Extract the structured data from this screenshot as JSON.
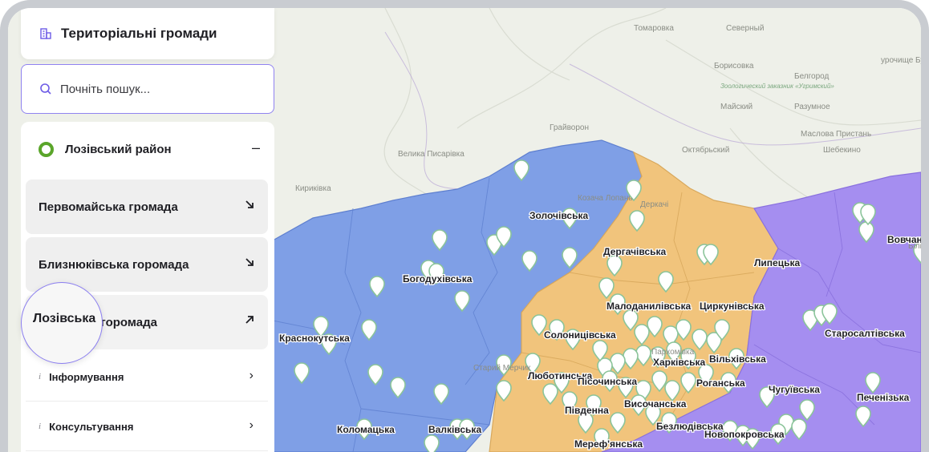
{
  "header": {
    "title": "Територіальні громади",
    "icon": "building-icon"
  },
  "search": {
    "placeholder": "Почніть пошук..."
  },
  "district": {
    "label": "Лозівський район",
    "toggle": "–",
    "color": "#5aa52a"
  },
  "communities": [
    {
      "label": "Первомайська громада",
      "arrow": "arrow-down-right-icon"
    },
    {
      "label": "Близнюківська горомада",
      "arrow": "arrow-down-right-icon"
    },
    {
      "label": "Лозівська горомада",
      "arrow": "arrow-up-right-icon",
      "expanded": true
    }
  ],
  "magnifier": {
    "label": "Лозівська"
  },
  "submenu": [
    {
      "icon": "i",
      "label": "Інформування",
      "chev": "›"
    },
    {
      "icon": "i",
      "label": "Консультування",
      "chev": "›"
    }
  ],
  "map": {
    "colors": {
      "blue": "#7f9fe6",
      "orange": "#f1c47c",
      "purple": "#a58ef0",
      "base": "#eef0e9",
      "pin": "#ffffff",
      "pin_ring": "#8bc49a"
    },
    "place_labels": [
      "Томаровка",
      "Северный",
      "Борисовка",
      "Зоологический заказник «Угримский»",
      "Белгород",
      "урочище Будённовская Дача",
      "Майский",
      "Разумное",
      "Грайворон",
      "Маслова Пристань",
      "Октябрьский",
      "Шебекино",
      "Велика Писарівка",
      "Кириківка",
      "Козача Лопань",
      "Деркачі",
      "Білий",
      "Старий Мерчик",
      "Пархомівка"
    ],
    "community_labels": [
      "Золочівська",
      "Богодухівська",
      "Дергачівська",
      "Липецька",
      "Вовчанська",
      "Малоданилівська",
      "Циркунівська",
      "Краснокутська",
      "Солоницівська",
      "Старосалтівська",
      "Вільхівська",
      "Харківська",
      "Люботинська",
      "Пісочинська",
      "Чугуївська",
      "Печенізька",
      "Роганська",
      "Височанська",
      "Південна",
      "Безлюдівська",
      "Коломацька",
      "Валківська",
      "Новопокровська",
      "Мереф'янська"
    ]
  }
}
